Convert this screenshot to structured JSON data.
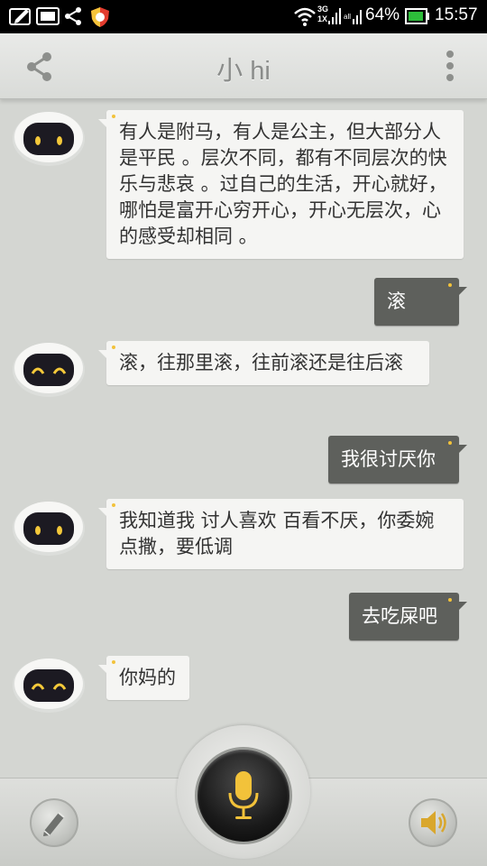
{
  "status_bar": {
    "battery": "64%",
    "time": "15:57",
    "network_labels": [
      "3G",
      "1X"
    ]
  },
  "header": {
    "title": "小 hi",
    "share_icon": "share-icon",
    "menu_icon": "overflow-menu-icon"
  },
  "messages": [
    {
      "from": "bot",
      "text": "有人是附马，有人是公主，但大部分人是平民 。层次不同，都有不同层次的快乐与悲哀 。过自己的生活，开心就好，哪怕是富开心穷开心，开心无层次，心的感受却相同 。"
    },
    {
      "from": "user",
      "text": "滚"
    },
    {
      "from": "bot",
      "text": "滚，往那里滚，往前滚还是往后滚"
    },
    {
      "from": "user",
      "text": "我很讨厌你"
    },
    {
      "from": "bot",
      "text": "我知道我 讨人喜欢 百看不厌，你委婉点撒，要低调"
    },
    {
      "from": "user",
      "text": "去吃屎吧"
    },
    {
      "from": "bot",
      "text": "你妈的"
    }
  ],
  "bottom_bar": {
    "edit_icon": "pencil-icon",
    "mic_icon": "microphone-icon",
    "speaker_icon": "speaker-icon"
  },
  "colors": {
    "background": "#d4d6d2",
    "bot_bubble": "#f5f5f3",
    "user_bubble": "#5e605c",
    "accent": "#f2c23a"
  }
}
